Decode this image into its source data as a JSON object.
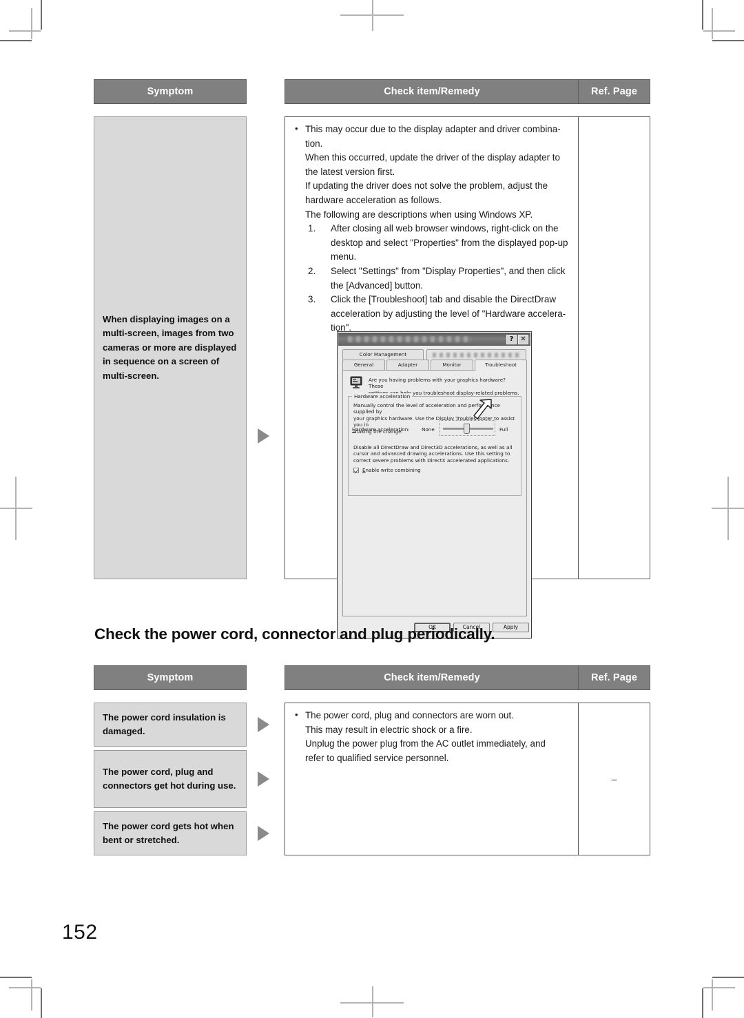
{
  "page": {
    "number": "152"
  },
  "table1": {
    "headers": {
      "symptom": "Symptom",
      "check": "Check item/Remedy",
      "ref": "Ref. Page"
    },
    "rows": [
      {
        "symptom": "When displaying images on a multi-screen, images from two cameras or more are displayed in sequence on a screen of multi-screen.",
        "ref": "",
        "remedy": {
          "bullet": "This may occur due to the display adapter and driver combina-",
          "lines": [
            "tion.",
            "When this occurred, update the driver of the display adapter to",
            "the latest version first.",
            "If updating the driver does not solve the problem, adjust the",
            "hardware acceleration as follows.",
            "The following are descriptions when using Windows XP."
          ],
          "steps": [
            {
              "num": "1.",
              "lines": [
                "After closing all web browser windows, right-click on the",
                "desktop and select \"Properties\" from the displayed pop-up",
                "menu."
              ]
            },
            {
              "num": "2.",
              "lines": [
                "Select \"Settings\" from \"Display Properties\", and then click",
                "the [Advanced] button."
              ]
            },
            {
              "num": "3.",
              "lines": [
                "Click the [Troubleshoot] tab and disable the DirectDraw",
                "acceleration by adjusting the level of \"Hardware accelera-",
                "tion\"."
              ]
            }
          ]
        }
      }
    ]
  },
  "heading2": "Check the power cord, connector and plug periodically.",
  "table2": {
    "headers": {
      "symptom": "Symptom",
      "check": "Check item/Remedy",
      "ref": "Ref. Page"
    },
    "symptoms": [
      "The power cord insulation is damaged.",
      "The power cord, plug and connectors get hot during use.",
      "The power cord gets hot when bent or stretched."
    ],
    "remedy": {
      "bullet": "The power cord, plug and connectors are worn out.",
      "lines": [
        "This may result in electric shock or a fire.",
        "Unplug the power plug from the AC outlet immediately, and",
        "refer to qualified service personnel."
      ]
    },
    "ref": "–"
  },
  "xp_dialog": {
    "title_bar": {
      "help_button": "?",
      "close_button": "✕"
    },
    "tabs_row1": [
      {
        "label": "Color Management",
        "blurred": false
      },
      {
        "label": "",
        "blurred": true
      }
    ],
    "tabs_row2": [
      {
        "label": "General",
        "active": false
      },
      {
        "label": "Adapter",
        "active": false
      },
      {
        "label": "Monitor",
        "active": false
      },
      {
        "label": "Troubleshoot",
        "active": true
      }
    ],
    "intro": [
      "Are you having problems with your graphics hardware? These",
      "settings can help you troubleshoot display-related problems."
    ],
    "group_label": "Hardware acceleration",
    "group_text": [
      "Manually control the level of acceleration and performance supplied by",
      "your graphics hardware. Use the Display Troubleshooter to assist you in",
      "making the change."
    ],
    "slider": {
      "label": "Hardware acceleration:",
      "min_label": "None",
      "max_label": "Full"
    },
    "description": [
      "Disable all DirectDraw and Direct3D accelerations, as well as all",
      "cursor and advanced drawing accelerations. Use this setting to",
      "correct severe problems with DirectX accelerated applications."
    ],
    "checkbox": {
      "label": "Enable write combining",
      "checked": true
    },
    "buttons": {
      "ok": "OK",
      "cancel": "Cancel",
      "apply": "Apply"
    }
  },
  "colors": {
    "header_bg": "#808080",
    "symptom_bg": "#d9d9d9",
    "arrow": "#8a8a8a",
    "crop_mark": "#6e6e6e"
  }
}
